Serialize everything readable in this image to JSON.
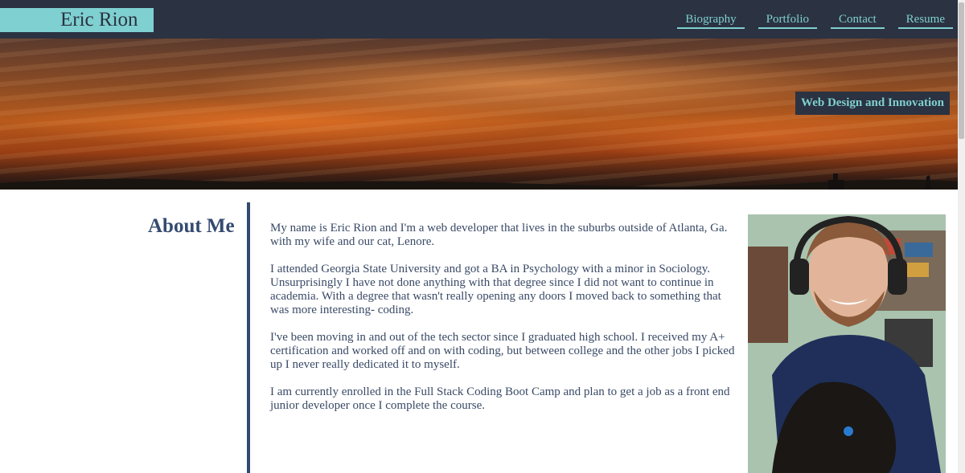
{
  "header": {
    "logo": "Eric Rion",
    "nav": [
      {
        "label": "Biography"
      },
      {
        "label": "Portfolio"
      },
      {
        "label": "Contact"
      },
      {
        "label": "Resume"
      }
    ]
  },
  "hero": {
    "tagline": "Web Design and Innovation"
  },
  "about": {
    "title": "About Me",
    "paragraphs": [
      "My name is Eric Rion and I'm a web developer that lives in the suburbs outside of Atlanta, Ga. with my wife and our cat, Lenore.",
      "I attended Georgia State University and got a BA in Psychology with a minor in Sociology. Unsurprisingly I have not done anything with that degree since I did not want to continue in academia. With a degree that wasn't really opening any doors I moved back to something that was more interesting- coding.",
      "I've been moving in and out of the tech sector since I graduated high school. I received my A+ certification and worked off and on with coding, but between college and the other jobs I picked up I never really dedicated it to myself.",
      "I am currently enrolled in the Full Stack Coding Boot Camp and plan to get a job as a front end junior developer once I complete the course."
    ]
  },
  "colors": {
    "header_bg": "#2b3241",
    "accent": "#7fd0d0",
    "heading": "#344a70"
  }
}
